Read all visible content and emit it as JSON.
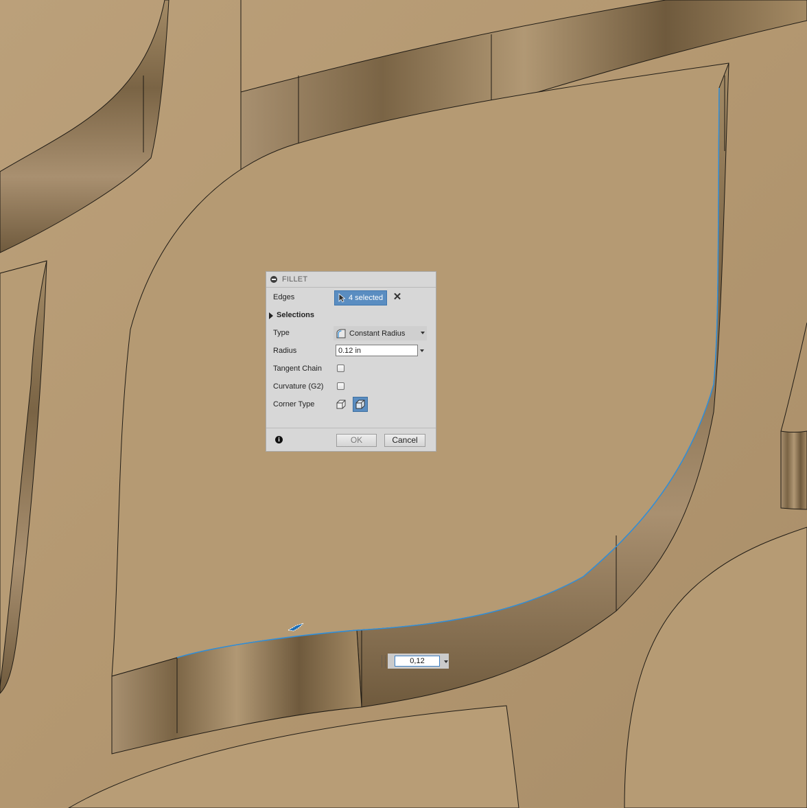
{
  "colors": {
    "surface": "#b49a72",
    "wall_dark": "#7a6445",
    "wall_light": "#a88f69",
    "edge_line": "#1e1a14",
    "selected_edge": "#2f8fdb",
    "selection_chip": "#5a8dc1",
    "dialog_bg": "#d7d7d7"
  },
  "dialog": {
    "title": "FILLET",
    "collapse_icon": "minus-circle-icon",
    "edges": {
      "label": "Edges",
      "value": "4 selected",
      "icon": "cursor-arrow-icon",
      "clear_icon": "close-icon"
    },
    "selections": {
      "label": "Selections",
      "expanded": false
    },
    "type": {
      "label": "Type",
      "value": "Constant Radius",
      "icon": "constant-radius-icon"
    },
    "radius": {
      "label": "Radius",
      "value": "0.12 in"
    },
    "tangent_chain": {
      "label": "Tangent Chain",
      "checked": false
    },
    "curvature": {
      "label": "Curvature (G2)",
      "checked": false
    },
    "corner_type": {
      "label": "Corner Type",
      "options": [
        "rolling-ball-corner-icon",
        "setback-corner-icon"
      ],
      "selected": "setback-corner-icon"
    },
    "info_icon": "info-icon",
    "ok_label": "OK",
    "cancel_label": "Cancel"
  },
  "canvas_input": {
    "value": "0,12"
  },
  "manipulator": {
    "icon": "fillet-drag-arrow-icon"
  }
}
